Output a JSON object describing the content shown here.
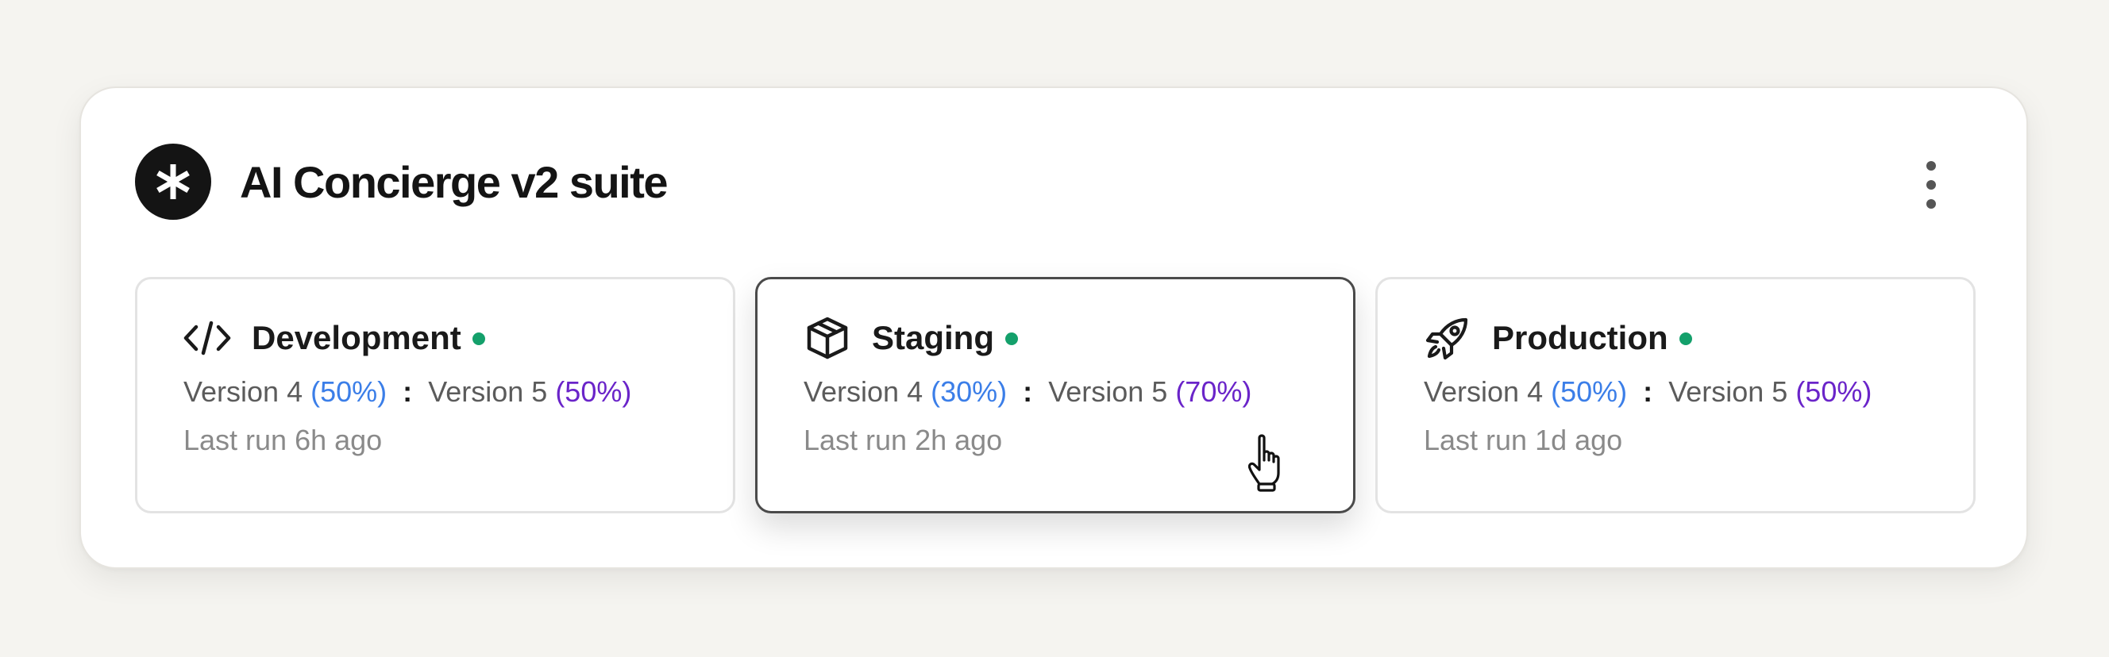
{
  "suite": {
    "title": "AI Concierge v2 suite",
    "logo_icon": "asterisk-icon",
    "menu_icon": "more-vertical-icon"
  },
  "environments": [
    {
      "name": "Development",
      "icon": "code-icon",
      "status": "active",
      "version_a_label": "Version 4",
      "version_a_pct": "(50%)",
      "separator": ":",
      "version_b_label": "Version 5",
      "version_b_pct": "(50%)",
      "last_run": "Last run 6h ago"
    },
    {
      "name": "Staging",
      "icon": "box-icon",
      "status": "active",
      "selected": true,
      "version_a_label": "Version 4",
      "version_a_pct": "(30%)",
      "separator": ":",
      "version_b_label": "Version 5",
      "version_b_pct": "(70%)",
      "last_run": "Last run 2h ago"
    },
    {
      "name": "Production",
      "icon": "rocket-icon",
      "status": "active",
      "version_a_label": "Version 4",
      "version_a_pct": "(50%)",
      "separator": ":",
      "version_b_label": "Version 5",
      "version_b_pct": "(50%)",
      "last_run": "Last run 1d ago"
    }
  ],
  "colors": {
    "status_active": "#14a06b",
    "version_a": "#3b7ee8",
    "version_b": "#6a24c9"
  }
}
